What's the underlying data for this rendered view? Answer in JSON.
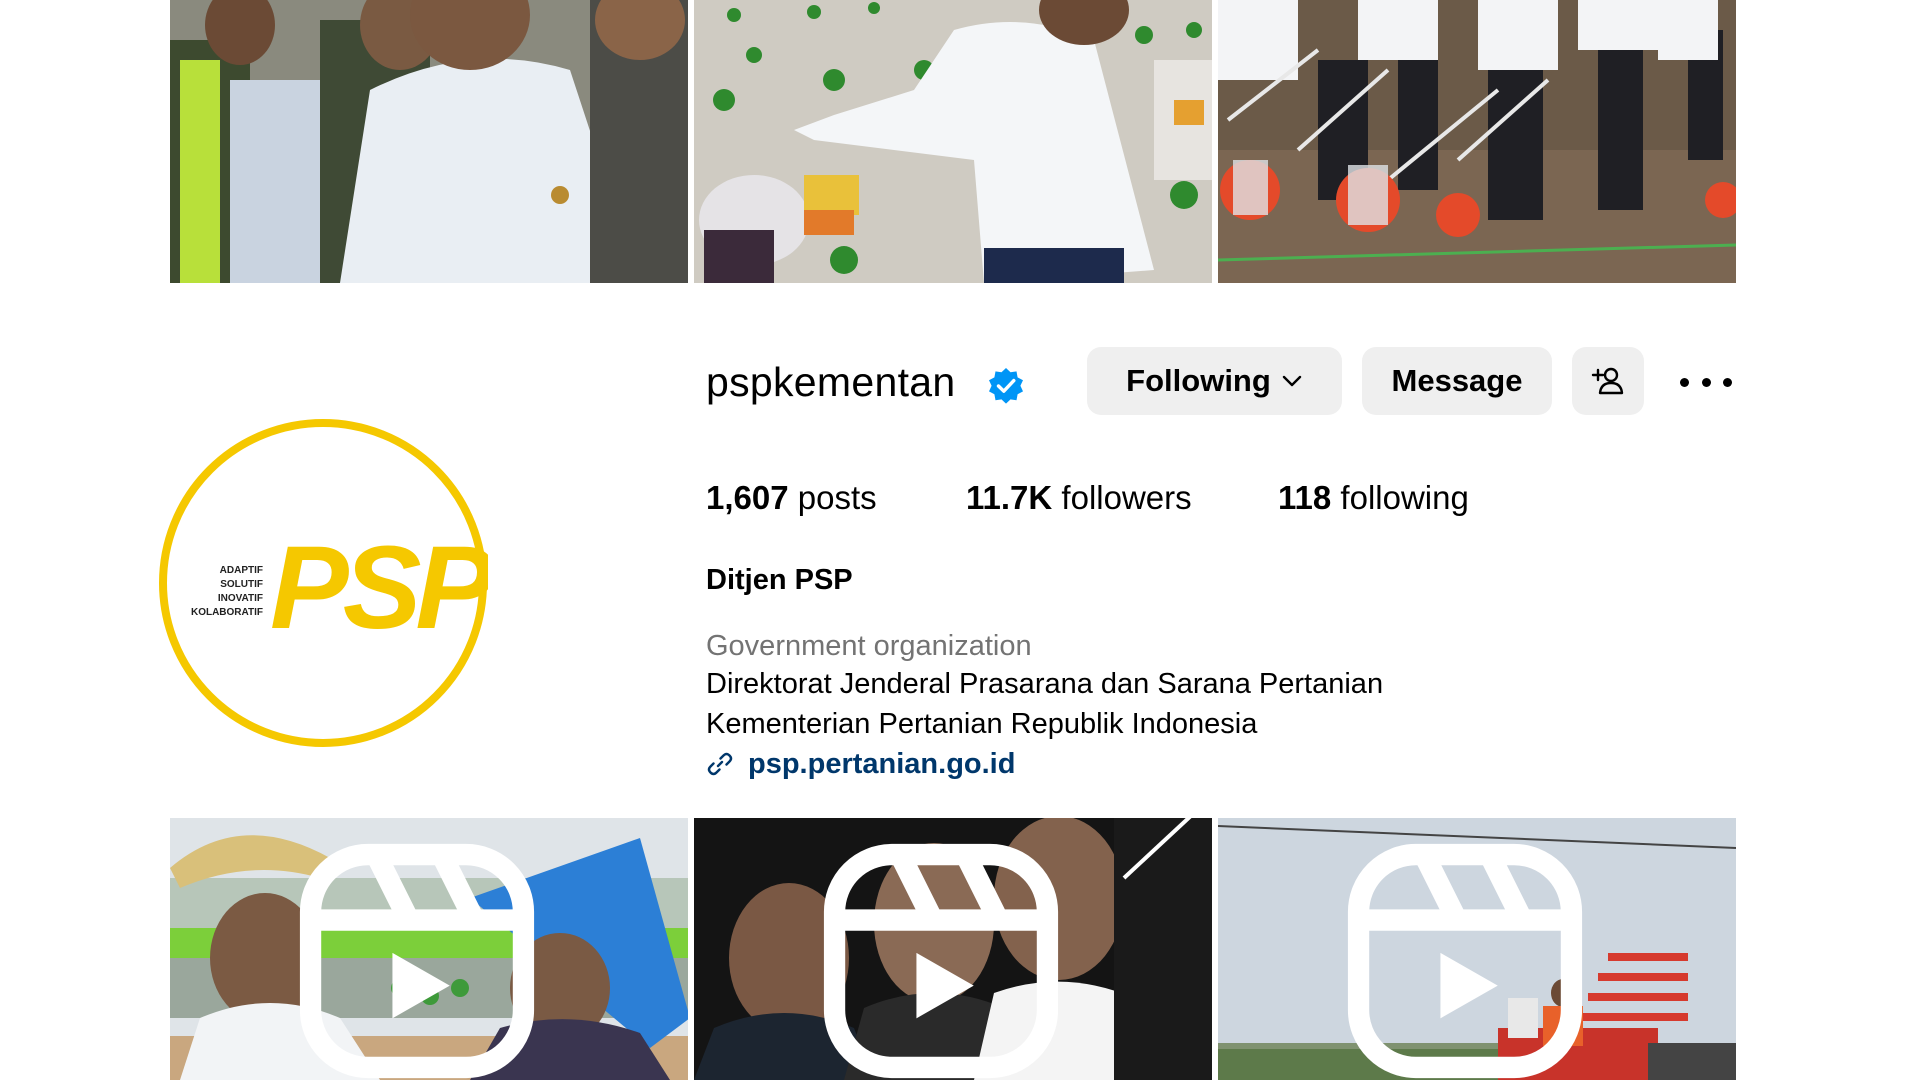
{
  "profile": {
    "username": "pspkementan",
    "verified": true,
    "display_name": "Ditjen PSP",
    "category": "Government organization",
    "bio_lines": [
      "Direktorat Jenderal Prasarana dan Sarana Pertanian",
      "Kementerian Pertanian Republik Indonesia"
    ],
    "link": "psp.pertanian.go.id",
    "avatar": {
      "logo_text": "PSP",
      "tagline": [
        "ADAPTIF",
        "SOLUTIF",
        "INOVATIF",
        "KOLABORATIF"
      ],
      "color": "#f5c800"
    }
  },
  "actions": {
    "following_label": "Following",
    "message_label": "Message"
  },
  "stats": {
    "posts_count": "1,607",
    "posts_label": "posts",
    "followers_count": "11.7K",
    "followers_label": "followers",
    "following_count": "118",
    "following_label": "following"
  },
  "colors": {
    "button_bg": "#efefef",
    "verified_blue": "#0095f6",
    "link_color": "#00376b",
    "muted_text": "#737373"
  },
  "posts": [
    {
      "row": "top",
      "description": "officials-in-crowd",
      "reel": false
    },
    {
      "row": "top",
      "description": "rice-planting-field",
      "reel": false
    },
    {
      "row": "top",
      "description": "seeder-machines",
      "reel": false
    },
    {
      "row": "bottom",
      "description": "farmers-with-hats",
      "reel": true
    },
    {
      "row": "bottom",
      "description": "officials-portrait",
      "reel": true
    },
    {
      "row": "bottom",
      "description": "rice-transplanter",
      "reel": true
    }
  ]
}
